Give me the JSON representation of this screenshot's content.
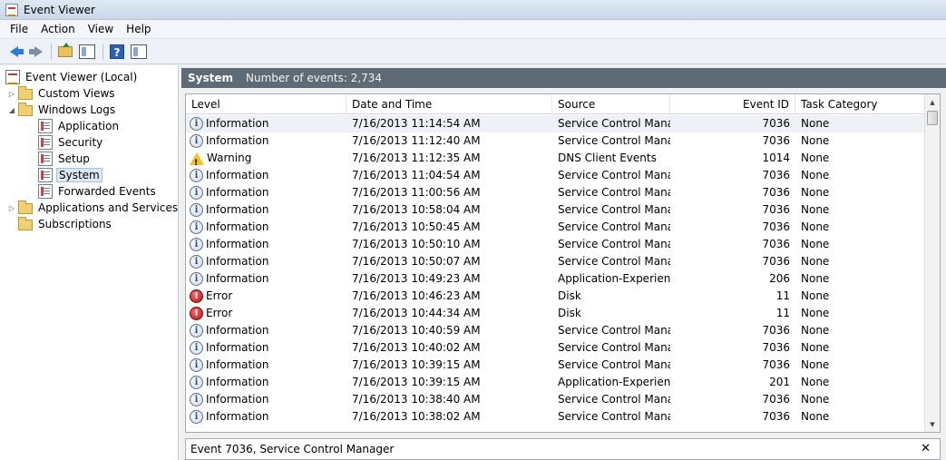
{
  "window": {
    "title": "Event Viewer"
  },
  "menu": [
    "File",
    "Action",
    "View",
    "Help"
  ],
  "tree": {
    "root": "Event Viewer (Local)",
    "custom_views": "Custom Views",
    "windows_logs": "Windows Logs",
    "application": "Application",
    "security": "Security",
    "setup": "Setup",
    "system": "System",
    "forwarded": "Forwarded Events",
    "apps_services": "Applications and Services Logs",
    "subscriptions": "Subscriptions"
  },
  "panel": {
    "log_name": "System",
    "count": "Number of events: 2,734"
  },
  "columns": {
    "level": "Level",
    "date": "Date and Time",
    "source": "Source",
    "event_id": "Event ID",
    "category": "Task Category"
  },
  "events": [
    {
      "level": "Information",
      "type": "info",
      "date": "7/16/2013 11:14:54 AM",
      "source": "Service Control Mana...",
      "id": "7036",
      "category": "None"
    },
    {
      "level": "Information",
      "type": "info",
      "date": "7/16/2013 11:12:40 AM",
      "source": "Service Control Mana...",
      "id": "7036",
      "category": "None"
    },
    {
      "level": "Warning",
      "type": "warning",
      "date": "7/16/2013 11:12:35 AM",
      "source": "DNS Client Events",
      "id": "1014",
      "category": "None"
    },
    {
      "level": "Information",
      "type": "info",
      "date": "7/16/2013 11:04:54 AM",
      "source": "Service Control Mana...",
      "id": "7036",
      "category": "None"
    },
    {
      "level": "Information",
      "type": "info",
      "date": "7/16/2013 11:00:56 AM",
      "source": "Service Control Mana...",
      "id": "7036",
      "category": "None"
    },
    {
      "level": "Information",
      "type": "info",
      "date": "7/16/2013 10:58:04 AM",
      "source": "Service Control Mana...",
      "id": "7036",
      "category": "None"
    },
    {
      "level": "Information",
      "type": "info",
      "date": "7/16/2013 10:50:45 AM",
      "source": "Service Control Mana...",
      "id": "7036",
      "category": "None"
    },
    {
      "level": "Information",
      "type": "info",
      "date": "7/16/2013 10:50:10 AM",
      "source": "Service Control Mana...",
      "id": "7036",
      "category": "None"
    },
    {
      "level": "Information",
      "type": "info",
      "date": "7/16/2013 10:50:07 AM",
      "source": "Service Control Mana...",
      "id": "7036",
      "category": "None"
    },
    {
      "level": "Information",
      "type": "info",
      "date": "7/16/2013 10:49:23 AM",
      "source": "Application-Experience",
      "id": "206",
      "category": "None"
    },
    {
      "level": "Error",
      "type": "error",
      "date": "7/16/2013 10:46:23 AM",
      "source": "Disk",
      "id": "11",
      "category": "None"
    },
    {
      "level": "Error",
      "type": "error",
      "date": "7/16/2013 10:44:34 AM",
      "source": "Disk",
      "id": "11",
      "category": "None"
    },
    {
      "level": "Information",
      "type": "info",
      "date": "7/16/2013 10:40:59 AM",
      "source": "Service Control Mana...",
      "id": "7036",
      "category": "None"
    },
    {
      "level": "Information",
      "type": "info",
      "date": "7/16/2013 10:40:02 AM",
      "source": "Service Control Mana...",
      "id": "7036",
      "category": "None"
    },
    {
      "level": "Information",
      "type": "info",
      "date": "7/16/2013 10:39:15 AM",
      "source": "Service Control Mana...",
      "id": "7036",
      "category": "None"
    },
    {
      "level": "Information",
      "type": "info",
      "date": "7/16/2013 10:39:15 AM",
      "source": "Application-Experience",
      "id": "201",
      "category": "None"
    },
    {
      "level": "Information",
      "type": "info",
      "date": "7/16/2013 10:38:40 AM",
      "source": "Service Control Mana...",
      "id": "7036",
      "category": "None"
    },
    {
      "level": "Information",
      "type": "info",
      "date": "7/16/2013 10:38:02 AM",
      "source": "Service Control Mana...",
      "id": "7036",
      "category": "None"
    }
  ],
  "details": {
    "title": "Event 7036, Service Control Manager",
    "close": "✕"
  }
}
